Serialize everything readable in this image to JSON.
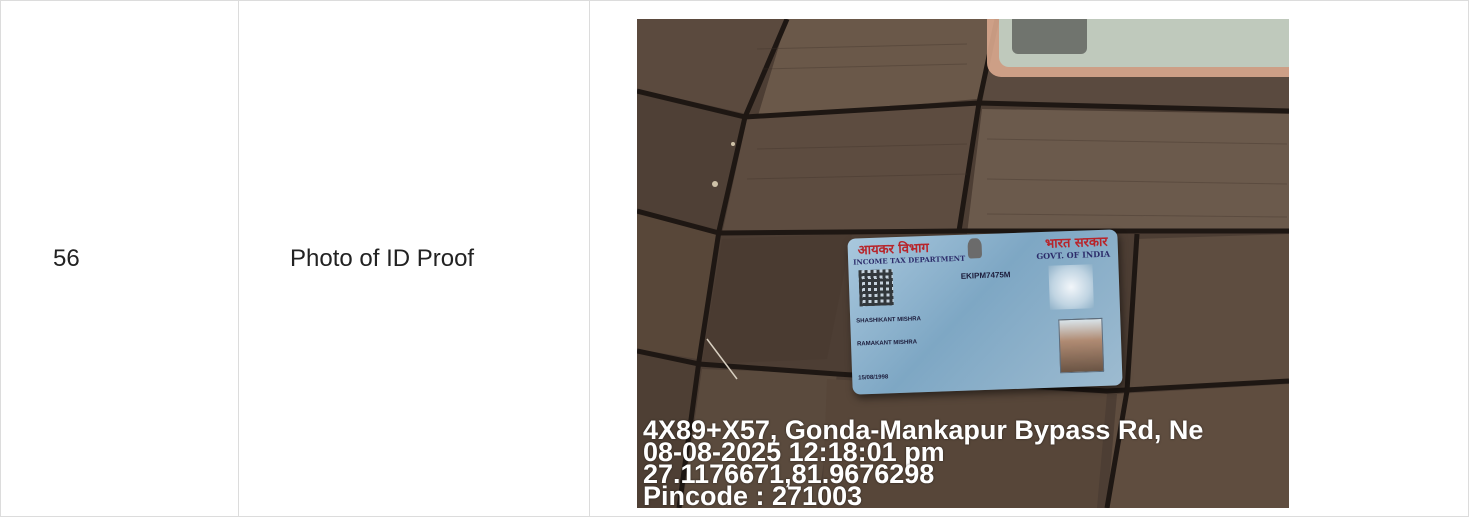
{
  "row": {
    "number": "56",
    "label": "Photo of ID Proof"
  },
  "photo": {
    "card": {
      "dept_hindi": "आयकर विभाग",
      "govt_hindi": "भारत सरकार",
      "dept_english": "INCOME TAX DEPARTMENT",
      "govt_english": "GOVT. OF INDIA",
      "pan_number": "EKIPM7475M",
      "holder_name": "SHASHIKANT MISHRA",
      "father_name": "RAMAKANT MISHRA",
      "dob": "15/08/1998"
    },
    "stamp": {
      "address": "4X89+X57, Gonda-Mankapur Bypass Rd, Ne",
      "datetime": "08-08-2025 12:18:01 pm",
      "coords": "27.1176671,81.9676298",
      "pincode": "Pincode : 271003"
    }
  },
  "colors": {
    "border": "#dcdcdc",
    "text": "#222222",
    "card_header_red": "#b8242a"
  }
}
